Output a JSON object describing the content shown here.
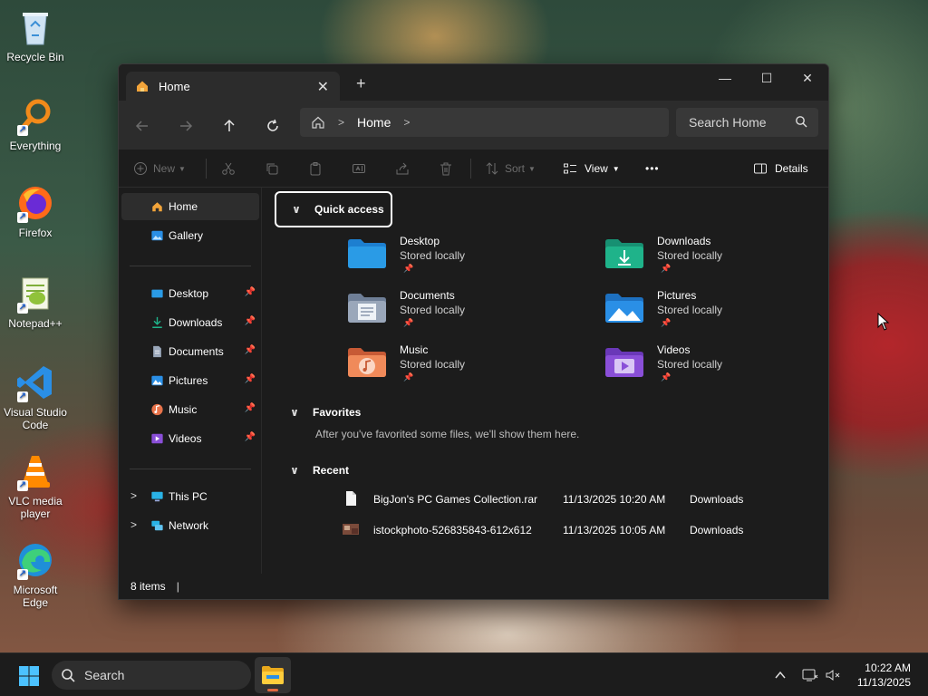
{
  "desktop": {
    "icons": [
      {
        "label": "Recycle Bin",
        "icon": "recycle-bin-icon"
      },
      {
        "label": "Everything",
        "icon": "everything-search-icon"
      },
      {
        "label": "Firefox",
        "icon": "firefox-icon"
      },
      {
        "label": "Notepad++",
        "icon": "notepad-plus-plus-icon"
      },
      {
        "label": "Visual Studio Code",
        "icon": "vscode-icon"
      },
      {
        "label": "VLC media player",
        "icon": "vlc-icon"
      },
      {
        "label": "Microsoft Edge",
        "icon": "edge-icon"
      }
    ]
  },
  "window": {
    "tab_title": "Home",
    "controls": {
      "minimize": "—",
      "maximize": "☐",
      "close": "✕"
    },
    "breadcrumb": [
      "Home"
    ],
    "search_placeholder": "Search Home",
    "toolbar": {
      "new_label": "New",
      "sort_label": "Sort",
      "view_label": "View",
      "more_label": "•••",
      "details_label": "Details"
    },
    "sidebar": {
      "top": [
        {
          "label": "Home",
          "icon": "home-icon",
          "active": true
        },
        {
          "label": "Gallery",
          "icon": "gallery-icon"
        }
      ],
      "pinned": [
        {
          "label": "Desktop",
          "icon": "desktop-folder-icon"
        },
        {
          "label": "Downloads",
          "icon": "downloads-icon"
        },
        {
          "label": "Documents",
          "icon": "documents-icon"
        },
        {
          "label": "Pictures",
          "icon": "pictures-icon"
        },
        {
          "label": "Music",
          "icon": "music-icon"
        },
        {
          "label": "Videos",
          "icon": "videos-icon"
        }
      ],
      "devices": [
        {
          "label": "This PC",
          "icon": "this-pc-icon"
        },
        {
          "label": "Network",
          "icon": "network-icon"
        }
      ]
    },
    "quick_access": {
      "title": "Quick access",
      "items": [
        {
          "name": "Desktop",
          "sub": "Stored locally",
          "color": "#2a9be6"
        },
        {
          "name": "Downloads",
          "sub": "Stored locally",
          "color": "#1fb38a"
        },
        {
          "name": "Documents",
          "sub": "Stored locally",
          "color": "#8e9db5"
        },
        {
          "name": "Pictures",
          "sub": "Stored locally",
          "color": "#2a8fe6"
        },
        {
          "name": "Music",
          "sub": "Stored locally",
          "color": "#e8734a"
        },
        {
          "name": "Videos",
          "sub": "Stored locally",
          "color": "#8a4fd8"
        }
      ]
    },
    "favorites": {
      "title": "Favorites",
      "empty_text": "After you've favorited some files, we'll show them here."
    },
    "recent": {
      "title": "Recent",
      "rows": [
        {
          "name": "BigJon's PC Games Collection.rar",
          "date": "11/13/2025 10:20 AM",
          "location": "Downloads"
        },
        {
          "name": "istockphoto-526835843-612x612",
          "date": "11/13/2025 10:05 AM",
          "location": "Downloads"
        }
      ]
    },
    "status": "8 items"
  },
  "taskbar": {
    "search_label": "Search",
    "time": "10:22 AM",
    "date": "11/13/2025"
  }
}
